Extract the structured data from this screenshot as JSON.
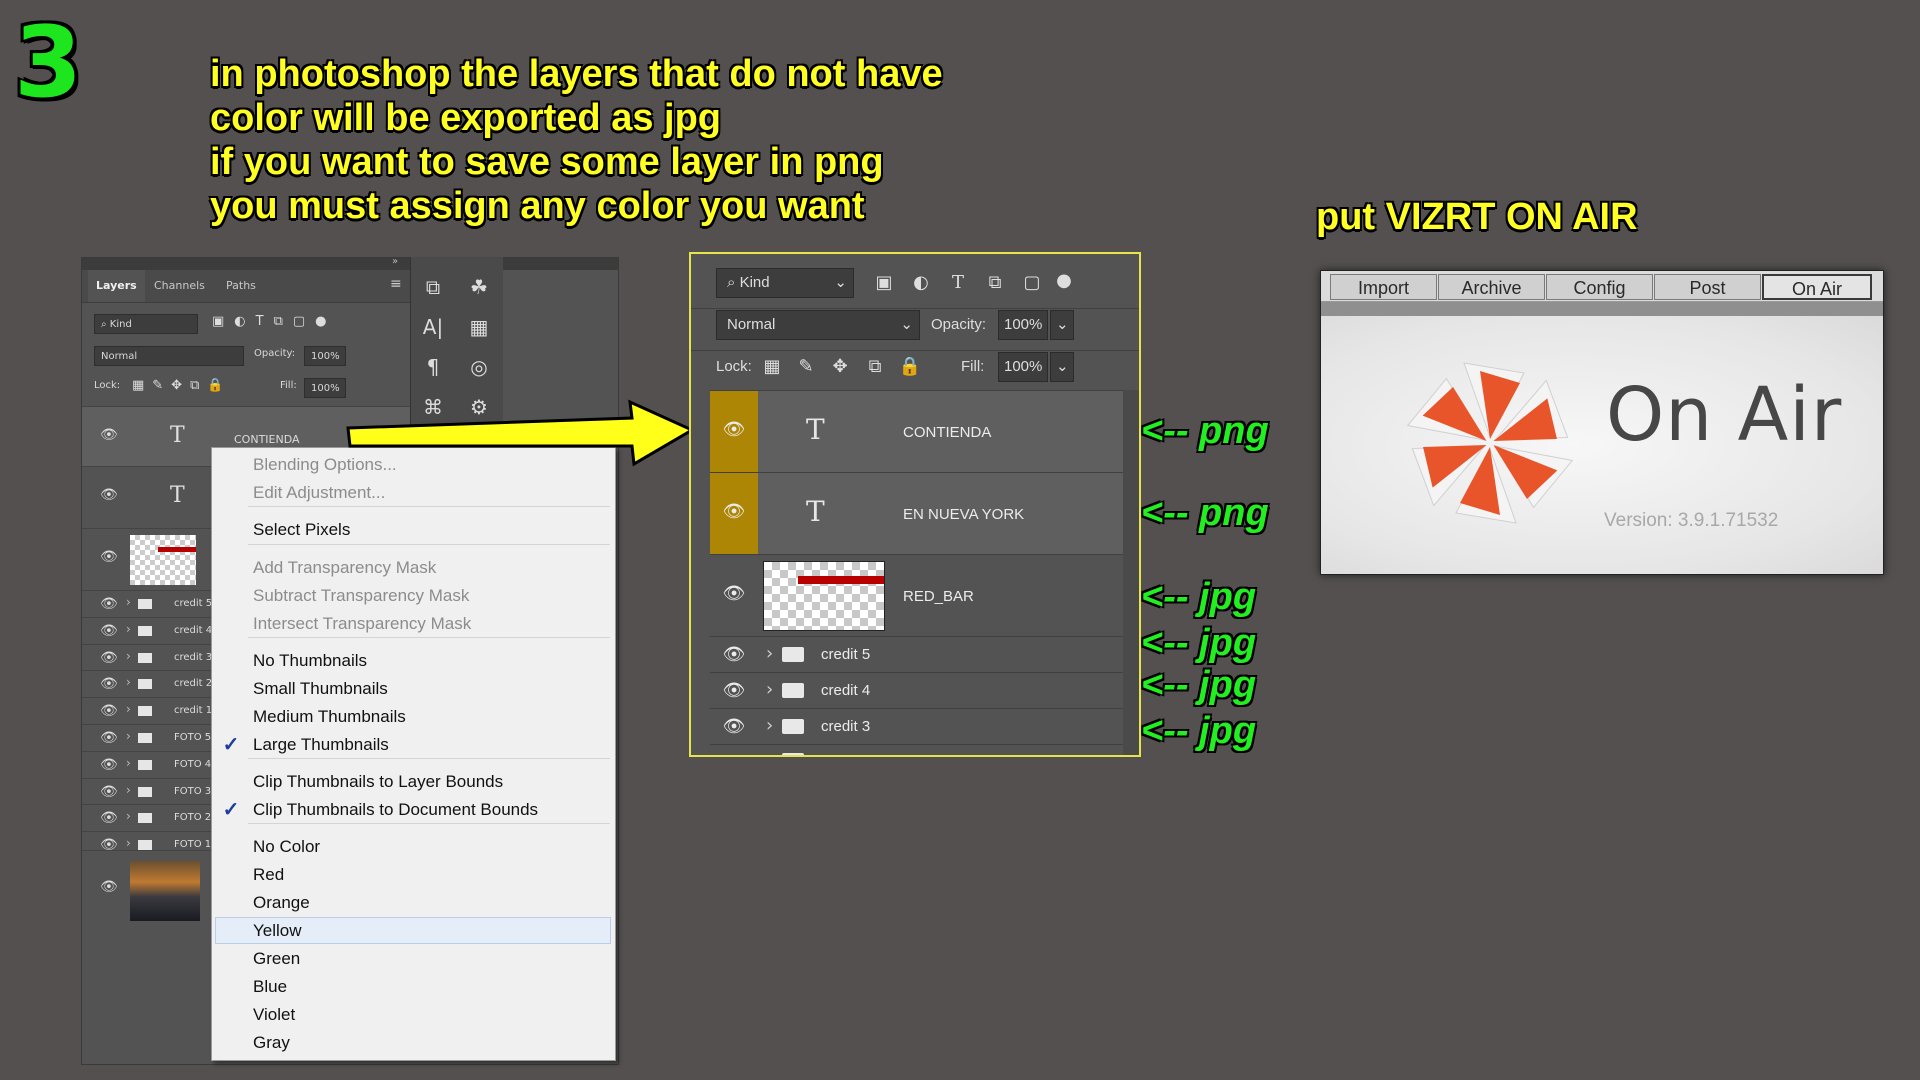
{
  "step": {
    "number": "3"
  },
  "headline": {
    "lines": [
      "in photoshop the layers that do not have",
      "color will be exported as jpg",
      "if you want to save some layer in png",
      "you must assign any color you want"
    ]
  },
  "vizrt_caption": "put VIZRT ON AIR",
  "colors": {
    "background": "#545050",
    "headline_yellow": "#ffff24",
    "step_green": "#1ee61e",
    "tag_green": "#22ee22",
    "layer_color_yellow": "#ae8606",
    "red_bar": "#b80000",
    "onair_orange": "#e8552a"
  },
  "small_panel": {
    "tabs": [
      "Layers",
      "Channels",
      "Paths"
    ],
    "filter_kind": "Kind",
    "blend_mode": "Normal",
    "opacity_label": "Opacity:",
    "opacity_value": "100%",
    "lock_label": "Lock:",
    "fill_label": "Fill:",
    "fill_value": "100%",
    "first_layer_name": "CONTIENDA",
    "folder_rows": [
      "credit 5",
      "credit 4",
      "credit 3",
      "credit 2",
      "credit 1",
      "FOTO 5",
      "FOTO 4",
      "FOTO 3",
      "FOTO 2",
      "FOTO 1"
    ]
  },
  "context_menu": {
    "items": [
      {
        "label": "Blending Options...",
        "disabled": true,
        "checked": false
      },
      {
        "label": "Edit Adjustment...",
        "disabled": true,
        "checked": false
      },
      {
        "label": "Select Pixels",
        "disabled": false,
        "checked": false
      },
      {
        "label": "Add Transparency Mask",
        "disabled": true,
        "checked": false
      },
      {
        "label": "Subtract Transparency Mask",
        "disabled": true,
        "checked": false
      },
      {
        "label": "Intersect Transparency Mask",
        "disabled": true,
        "checked": false
      },
      {
        "label": "No Thumbnails",
        "disabled": false,
        "checked": false
      },
      {
        "label": "Small Thumbnails",
        "disabled": false,
        "checked": false
      },
      {
        "label": "Medium Thumbnails",
        "disabled": false,
        "checked": false
      },
      {
        "label": "Large Thumbnails",
        "disabled": false,
        "checked": true
      },
      {
        "label": "Clip Thumbnails to Layer Bounds",
        "disabled": false,
        "checked": false
      },
      {
        "label": "Clip Thumbnails to Document Bounds",
        "disabled": false,
        "checked": true
      },
      {
        "label": "No Color",
        "disabled": false,
        "checked": false
      },
      {
        "label": "Red",
        "disabled": false,
        "checked": false
      },
      {
        "label": "Orange",
        "disabled": false,
        "checked": false
      },
      {
        "label": "Yellow",
        "disabled": false,
        "checked": false,
        "highlighted": true
      },
      {
        "label": "Green",
        "disabled": false,
        "checked": false
      },
      {
        "label": "Blue",
        "disabled": false,
        "checked": false
      },
      {
        "label": "Violet",
        "disabled": false,
        "checked": false
      },
      {
        "label": "Gray",
        "disabled": false,
        "checked": false
      }
    ]
  },
  "zoom_panel": {
    "filter_kind": "Kind",
    "blend_mode": "Normal",
    "opacity_label": "Opacity:",
    "opacity_value": "100%",
    "lock_label": "Lock:",
    "fill_label": "Fill:",
    "fill_value": "100%",
    "layers": [
      {
        "name": "CONTIENDA",
        "kind": "text",
        "color_tag": "yellow"
      },
      {
        "name": "EN NUEVA YORK",
        "kind": "text",
        "color_tag": "yellow"
      },
      {
        "name": "RED_BAR",
        "kind": "raster",
        "color_tag": "none"
      },
      {
        "name": "credit 5",
        "kind": "group",
        "color_tag": "none"
      },
      {
        "name": "credit 4",
        "kind": "group",
        "color_tag": "none"
      },
      {
        "name": "credit 3",
        "kind": "group",
        "color_tag": "none"
      }
    ]
  },
  "export_tags": [
    "<-- png",
    "<-- png",
    "<-- jpg",
    "<-- jpg",
    "<-- jpg",
    "<-- jpg"
  ],
  "onair": {
    "tabs": [
      "Import",
      "Archive",
      "Config",
      "Post",
      "On Air"
    ],
    "active_tab": "On Air",
    "title": "On Air",
    "version": "Version: 3.9.1.71532"
  }
}
